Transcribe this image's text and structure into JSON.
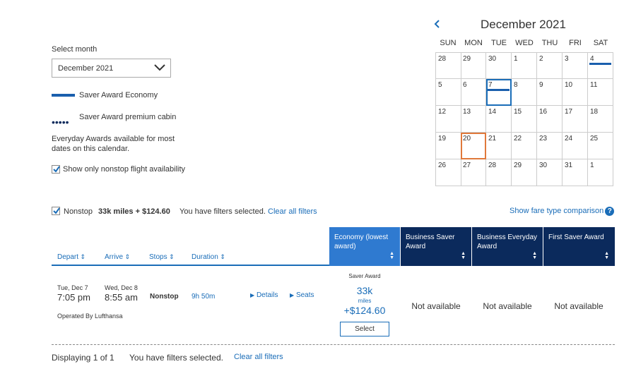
{
  "filters": {
    "select_month_label": "Select month",
    "month_value": "December 2021",
    "legend_saver_economy": "Saver Award Economy",
    "legend_saver_premium": "Saver Award premium cabin",
    "everyday_note": "Everyday Awards available for most dates on this calendar.",
    "nonstop_only_label": "Show only nonstop flight availability",
    "nonstop_only_checked": true
  },
  "calendar": {
    "prev_icon": "chevron-left-icon",
    "title": "December 2021",
    "days_of_week": [
      "SUN",
      "MON",
      "TUE",
      "WED",
      "THU",
      "FRI",
      "SAT"
    ],
    "weeks": [
      [
        "28",
        "29",
        "30",
        "1",
        "2",
        "3",
        "4"
      ],
      [
        "5",
        "6",
        "7",
        "8",
        "9",
        "10",
        "11"
      ],
      [
        "12",
        "13",
        "14",
        "15",
        "16",
        "17",
        "18"
      ],
      [
        "19",
        "20",
        "21",
        "22",
        "23",
        "24",
        "25"
      ],
      [
        "26",
        "27",
        "28",
        "29",
        "30",
        "31",
        "1"
      ]
    ],
    "saver_days": [
      "4",
      "7"
    ],
    "selected_day": "7",
    "highlighted_day": "20",
    "accent_color": "#1a5fad",
    "highlight_color": "#e0793b"
  },
  "summary": {
    "nonstop_label": "Nonstop",
    "price": "33k miles + $124.60",
    "filters_msg": "You have filters selected.",
    "clear_filters": "Clear all filters",
    "fare_compare": "Show fare type comparison"
  },
  "table": {
    "sort_headers": [
      "Depart",
      "Arrive",
      "Stops",
      "Duration"
    ],
    "fare_headers": [
      {
        "label": "Economy (lowest award)",
        "active": true
      },
      {
        "label": "Business Saver Award",
        "active": false
      },
      {
        "label": "Business Everyday Award",
        "active": false
      },
      {
        "label": "First Saver Award",
        "active": false
      }
    ],
    "flight": {
      "depart_date": "Tue, Dec 7",
      "depart_time": "7:05 pm",
      "arrive_date": "Wed, Dec 8",
      "arrive_time": "8:55 am",
      "stops": "Nonstop",
      "duration": "9h 50m",
      "details": "Details",
      "seats": "Seats",
      "operated_by": "Operated By Lufthansa",
      "economy_label": "Saver Award",
      "economy_miles": "33k",
      "miles_unit": "miles",
      "economy_tax": "+$124.60",
      "select_label": "Select",
      "not_available": "Not available"
    }
  },
  "footer": {
    "displaying": "Displaying 1 of 1",
    "filters_msg": "You have filters selected.",
    "clear_filters": "Clear all filters"
  },
  "colors": {
    "primary_blue": "#1a6db8",
    "navy": "#0b2a5c",
    "active_header": "#2f7ad0"
  }
}
